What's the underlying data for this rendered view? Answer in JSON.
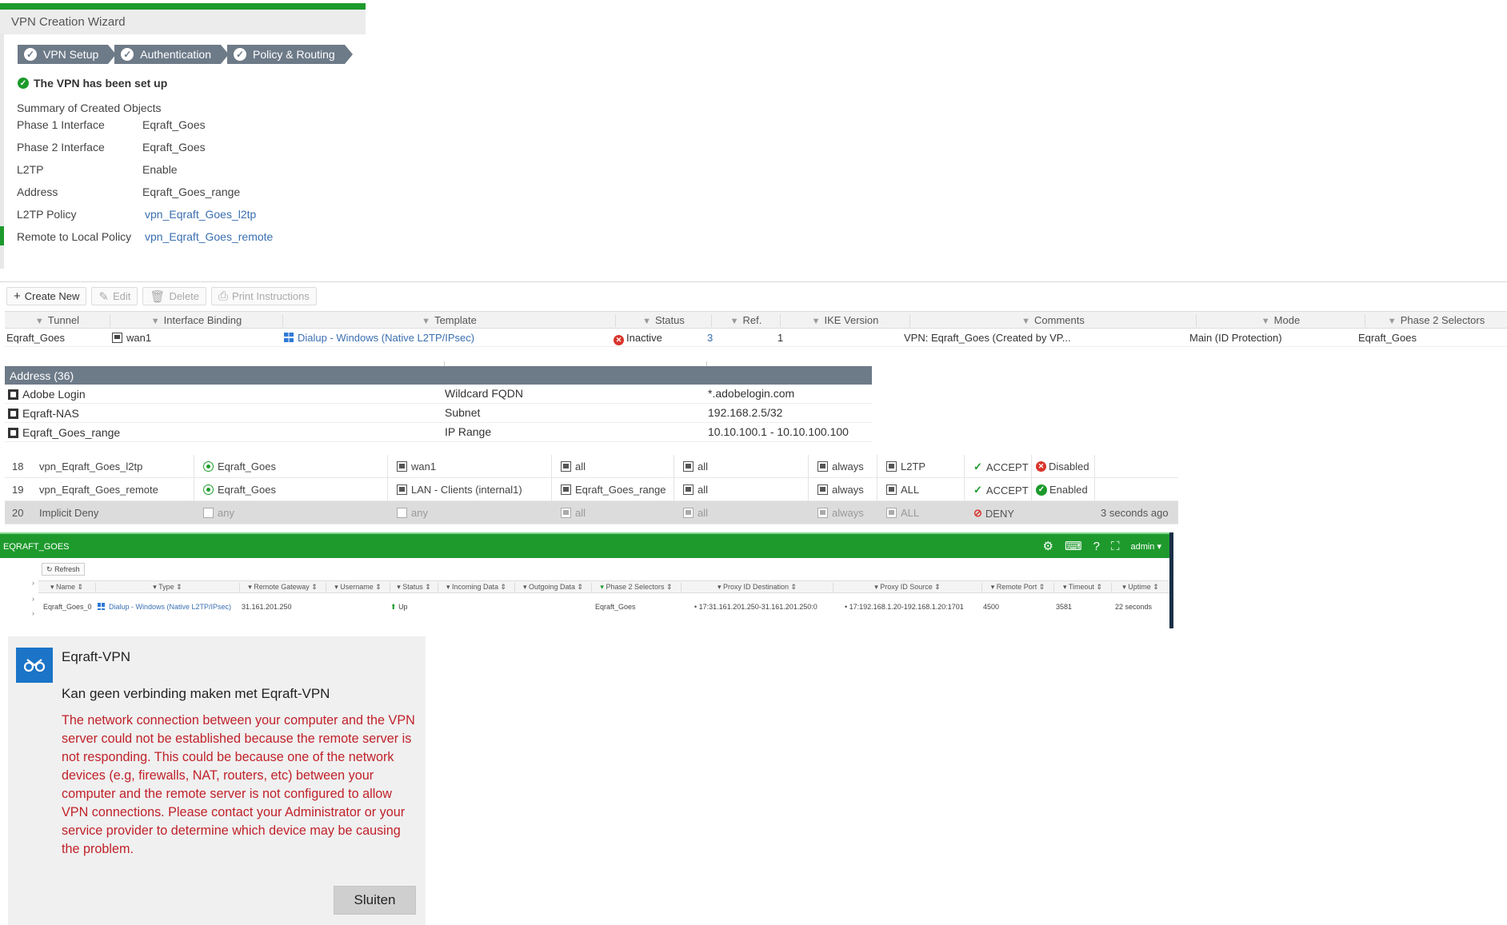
{
  "wizard": {
    "title": "VPN Creation Wizard",
    "steps": [
      "VPN Setup",
      "Authentication",
      "Policy & Routing"
    ],
    "success_message": "The VPN has been set up",
    "summary_title": "Summary of Created Objects",
    "summary": [
      {
        "key": "Phase 1 Interface",
        "value": "Eqraft_Goes"
      },
      {
        "key": "Phase 2 Interface",
        "value": "Eqraft_Goes"
      },
      {
        "key": "L2TP",
        "value": "Enable"
      },
      {
        "key": "Address",
        "value": "Eqraft_Goes_range"
      },
      {
        "key": "L2TP Policy",
        "value": "vpn_Eqraft_Goes_l2tp"
      },
      {
        "key": "Remote to Local Policy",
        "value": "vpn_Eqraft_Goes_remote"
      }
    ]
  },
  "toolbar": {
    "create_new": "Create New",
    "edit": "Edit",
    "delete": "Delete",
    "print": "Print Instructions"
  },
  "tunnel_table": {
    "headers": [
      "Tunnel",
      "Interface Binding",
      "Template",
      "Status",
      "Ref.",
      "IKE Version",
      "Comments",
      "Mode",
      "Phase 2 Selectors"
    ],
    "row": {
      "tunnel": "Eqraft_Goes",
      "interface": "wan1",
      "template": "Dialup - Windows (Native L2TP/IPsec)",
      "status": "Inactive",
      "ref": "3",
      "ike": "1",
      "comments": "VPN: Eqraft_Goes (Created by VP...",
      "mode": "Main (ID Protection)",
      "phase2": "Eqraft_Goes"
    }
  },
  "address_panel": {
    "title": "Address (36)",
    "rows": [
      {
        "name": "Adobe Login",
        "type": "Wildcard FQDN",
        "value": "*.adobelogin.com"
      },
      {
        "name": "Eqraft-NAS",
        "type": "Subnet",
        "value": "192.168.2.5/32"
      },
      {
        "name": "Eqraft_Goes_range",
        "type": "IP Range",
        "value": "10.10.100.1 - 10.10.100.100"
      }
    ]
  },
  "policies": [
    {
      "id": "18",
      "name": "vpn_Eqraft_Goes_l2tp",
      "src_if": "Eqraft_Goes",
      "dst_if": "wan1",
      "src": "all",
      "dst": "all",
      "schedule": "always",
      "service": "L2TP",
      "action": "ACCEPT",
      "state": "Disabled",
      "extra": ""
    },
    {
      "id": "19",
      "name": "vpn_Eqraft_Goes_remote",
      "src_if": "Eqraft_Goes",
      "dst_if": "LAN - Clients (internal1)",
      "src": "Eqraft_Goes_range",
      "dst": "all",
      "schedule": "always",
      "service": "ALL",
      "action": "ACCEPT",
      "state": "Enabled",
      "extra": ""
    },
    {
      "id": "20",
      "name": "Implicit Deny",
      "src_if": "any",
      "dst_if": "any",
      "src": "all",
      "dst": "all",
      "schedule": "always",
      "service": "ALL",
      "action": "DENY",
      "state": "",
      "extra": "3 seconds ago"
    }
  ],
  "monitor": {
    "title": "EQRAFT_GOES",
    "admin": "admin",
    "refresh": "Refresh",
    "headers": [
      "Name",
      "Type",
      "Remote Gateway",
      "Username",
      "Status",
      "Incoming Data",
      "Outgoing Data",
      "Phase 2 Selectors",
      "Proxy ID Destination",
      "Proxy ID Source",
      "Remote Port",
      "Timeout",
      "Uptime"
    ],
    "row": {
      "name": "Eqraft_Goes_0",
      "type": "Dialup - Windows (Native L2TP/IPsec)",
      "gateway": "31.161.201.250",
      "username": "",
      "status": "Up",
      "incoming": "",
      "outgoing": "",
      "phase2": "Eqraft_Goes",
      "proxy_dst": "17:31.161.201.250-31.161.201.250:0",
      "proxy_src": "17:192.168.1.20-192.168.1.20:1701",
      "remote_port": "4500",
      "timeout": "3581",
      "uptime": "22 seconds"
    }
  },
  "dialog": {
    "app_name": "Eqraft-VPN",
    "subtitle": "Kan geen verbinding maken met Eqraft-VPN",
    "error": "The network connection between your computer and the VPN server could not be established because the remote server is not responding. This could be because one of the network devices (e.g, firewalls, NAT, routers, etc) between your computer and the remote server is not configured to allow VPN connections. Please contact your Administrator or your service provider to determine which device may be causing the problem.",
    "close_button": "Sluiten"
  },
  "colors": {
    "fortinet_green": "#1d9a2c",
    "header_gray": "#6d7a88",
    "link_blue": "#3a6fb0",
    "error_red": "#c0222a",
    "windows_blue": "#1b74c7"
  }
}
